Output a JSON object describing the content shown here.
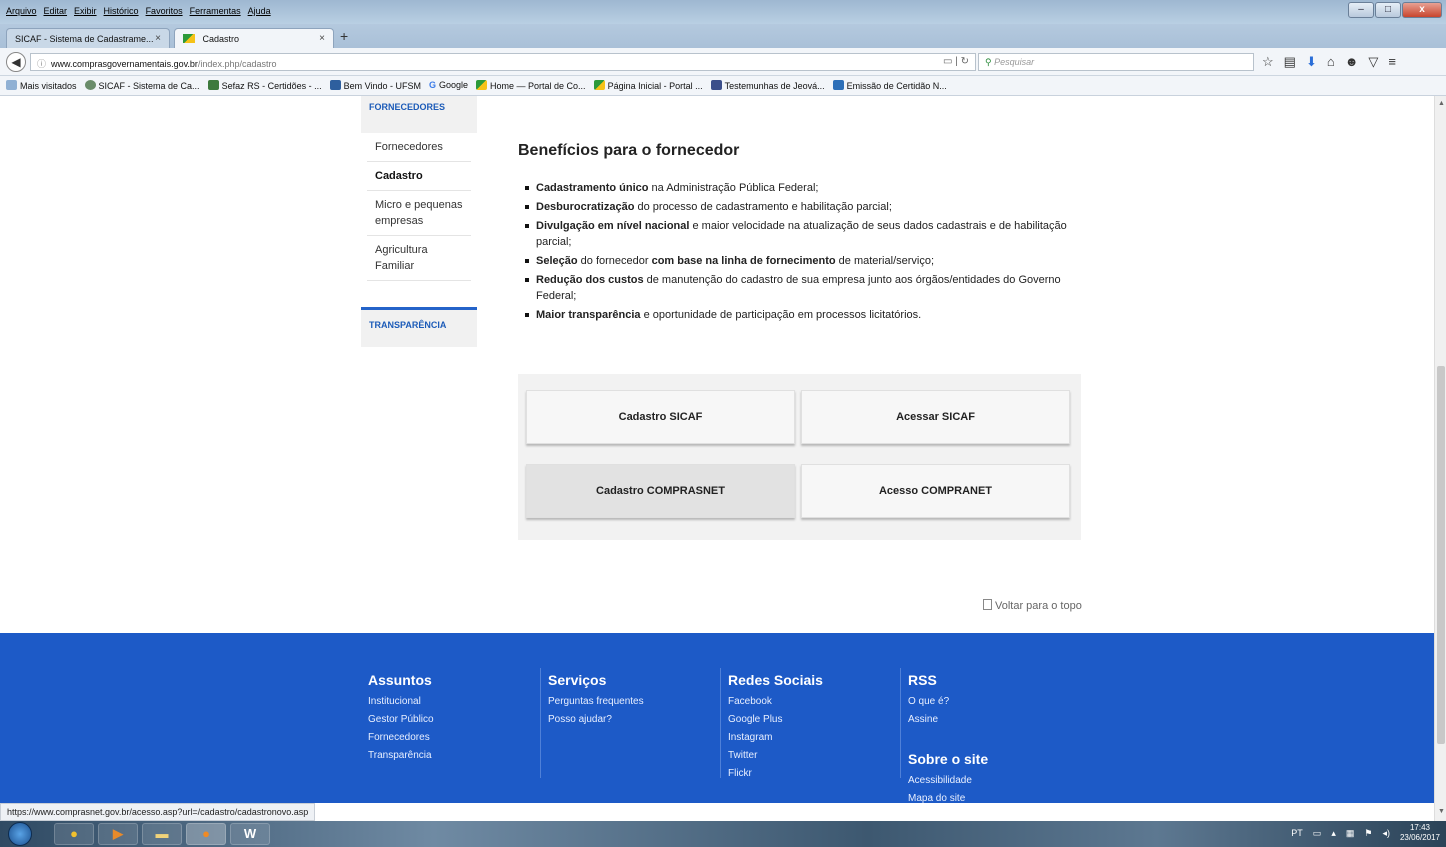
{
  "browser": {
    "menus": [
      "Arquivo",
      "Editar",
      "Exibir",
      "Histórico",
      "Favoritos",
      "Ferramentas",
      "Ajuda"
    ],
    "window_buttons": {
      "minimize": "–",
      "maximize": "□",
      "close": "x"
    },
    "tabs": [
      {
        "label": "SICAF - Sistema de Cadastrame..."
      },
      {
        "label": "Cadastro"
      }
    ],
    "new_tab": "+",
    "url_domain": "www.comprasgovernamentais.gov.br",
    "url_path": "/index.php/cadastro",
    "search_placeholder": "Pesquisar",
    "bookmarks": [
      "Mais visitados",
      "SICAF - Sistema de Ca...",
      "Sefaz RS - Certidões - ...",
      "Bem Vindo - UFSM",
      "Google",
      "Home — Portal de Co...",
      "Página Inicial - Portal ...",
      "Testemunhas de Jeová...",
      "Emissão de Certidão N..."
    ],
    "status_url": "https://www.comprasnet.gov.br/acesso.asp?url=/cadastro/cadastronovo.asp"
  },
  "sidebar": {
    "header": "FORNECEDORES",
    "items": [
      {
        "label": "Fornecedores"
      },
      {
        "label": "Cadastro"
      },
      {
        "label": "Micro e pequenas empresas"
      },
      {
        "label": "Agricultura Familiar"
      }
    ],
    "transparencia": "TRANSPARÊNCIA"
  },
  "main": {
    "title": "Benefícios para o fornecedor",
    "benefits": [
      {
        "bold": "Cadastramento único",
        "text": " na Administração Pública Federal;"
      },
      {
        "bold": "Desburocratização",
        "text": " do processo de cadastramento e habilitação parcial;"
      },
      {
        "bold": "Divulgação em nível nacional",
        "text": " e maior velocidade na atualização de seus dados cadastrais e de habilitação parcial;"
      },
      {
        "bold": "Seleção",
        "text": " do fornecedor ",
        "bold2": "com base na linha de fornecimento",
        "text2": " de material/serviço;"
      },
      {
        "bold": "Redução dos custos",
        "text": " de manutenção do cadastro de sua empresa junto aos órgãos/entidades do Governo Federal;"
      },
      {
        "bold": "Maior transparência",
        "text": " e oportunidade de participação em processos licitatórios."
      }
    ],
    "buttons": {
      "cadastro_sicaf": "Cadastro SICAF",
      "acessar_sicaf": "Acessar SICAF",
      "cadastro_comprasnet": "Cadastro COMPRASNET",
      "acesso_compranet": "Acesso COMPRANET"
    },
    "back_to_top": "Voltar para o topo"
  },
  "footer": {
    "assuntos": {
      "title": "Assuntos",
      "links": [
        "Institucional",
        "Gestor Público",
        "Fornecedores",
        "Transparência"
      ]
    },
    "servicos": {
      "title": "Serviços",
      "links": [
        "Perguntas frequentes",
        "Posso ajudar?"
      ]
    },
    "redes": {
      "title": "Redes Sociais",
      "links": [
        "Facebook",
        "Google Plus",
        "Instagram",
        "Twitter",
        "Flickr"
      ]
    },
    "rss": {
      "title": "RSS",
      "links": [
        "O que é?",
        "Assine"
      ]
    },
    "sobre": {
      "title": "Sobre o site",
      "links": [
        "Acessibilidade",
        "Mapa do site"
      ]
    }
  },
  "taskbar": {
    "lang": "PT",
    "time": "17:43",
    "date": "23/06/2017",
    "word_label": "W"
  },
  "colors": {
    "accent": "#1d5ac7",
    "sidebar_link": "#1c5bb8"
  }
}
